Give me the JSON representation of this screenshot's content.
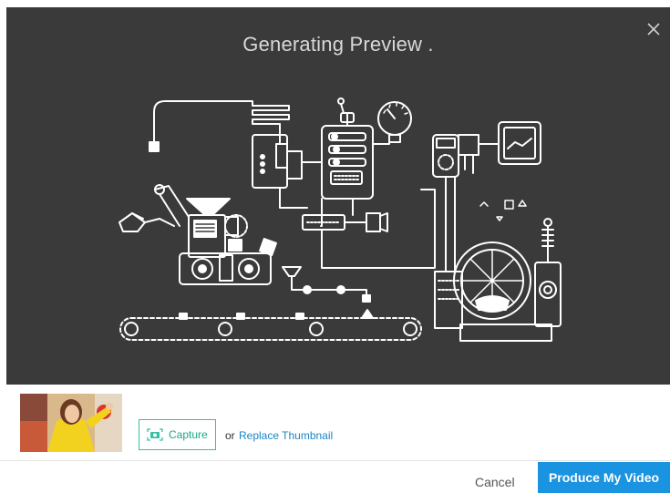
{
  "preview": {
    "title": "Generating Preview .",
    "close_icon": "close-icon",
    "illustration": "assembly-machine-illustration",
    "background_color": "#3a3a3a"
  },
  "thumbnail": {
    "capture_label": "Capture",
    "capture_icon": "camera-icon",
    "or_text": "or",
    "replace_label": "Replace Thumbnail"
  },
  "footer": {
    "cancel_label": "Cancel",
    "produce_label": "Produce My Video"
  },
  "colors": {
    "accent": "#1a93e0",
    "capture_accent": "#35c0a2",
    "link": "#1a86c6"
  }
}
